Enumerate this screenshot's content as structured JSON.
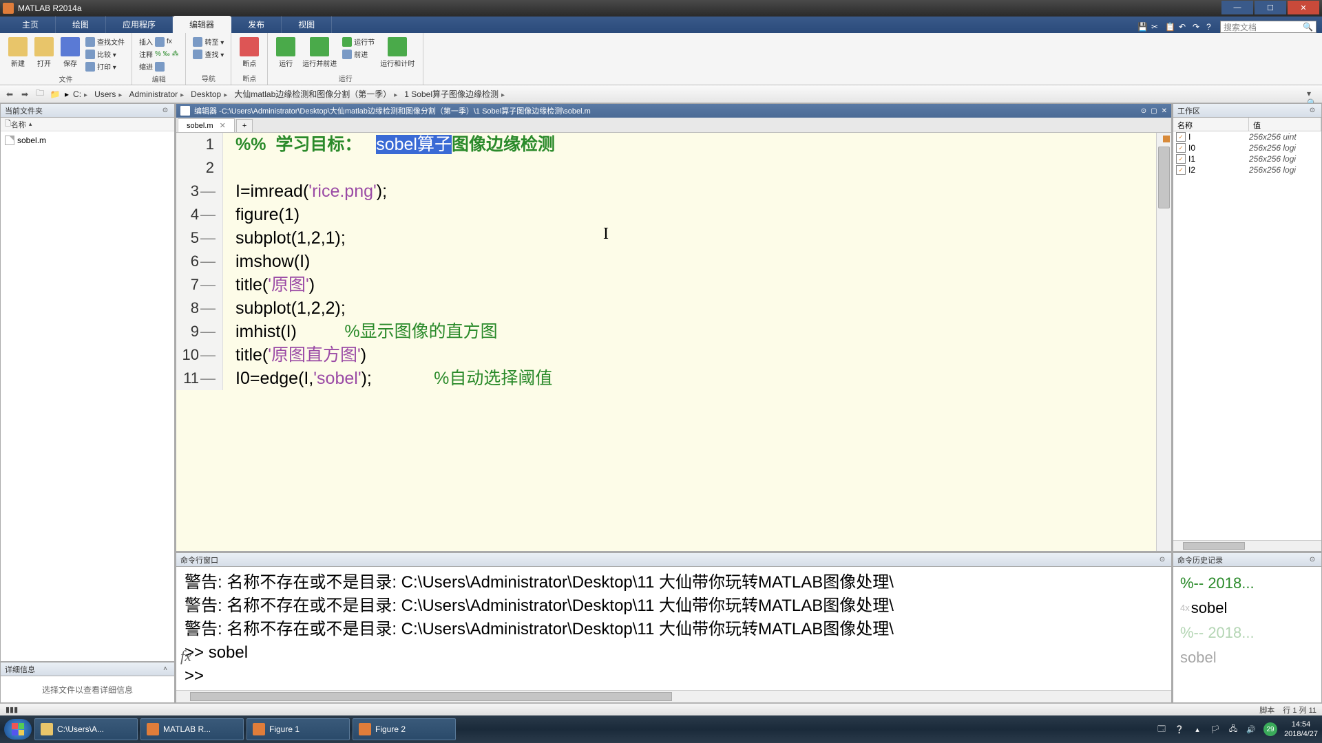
{
  "app_title": "MATLAB R2014a",
  "ribbon_tabs": [
    "主页",
    "绘图",
    "应用程序",
    "编辑器",
    "发布",
    "视图"
  ],
  "ribbon_active": 3,
  "search_placeholder": "搜索文档",
  "toolstrip": {
    "g1": {
      "new": "新建",
      "open": "打开",
      "save": "保存",
      "findfiles": "查找文件",
      "compare": "比较 ▾",
      "print": "打印 ▾",
      "label": "文件"
    },
    "g2": {
      "insert": "插入",
      "fx": "fx",
      "comment": "注释",
      "indent": "缩进",
      "label": "编辑"
    },
    "g3": {
      "goto": "转至 ▾",
      "find": "查找 ▾",
      "label": "导航"
    },
    "g4": {
      "bp": "断点",
      "label": "断点"
    },
    "g5": {
      "run": "运行",
      "runadv": "运行并前进",
      "runsec": "运行节",
      "advance": "前进",
      "runtime": "运行和计时",
      "label": "运行"
    }
  },
  "breadcrumbs": [
    "C:",
    "Users",
    "Administrator",
    "Desktop",
    "大仙matlab边缘检测和图像分割（第一季）",
    "1 Sobel算子图像边缘检测"
  ],
  "left": {
    "cf_title": "当前文件夹",
    "name_col": "名称",
    "files": [
      "sobel.m"
    ],
    "details_title": "详细信息",
    "details_msg": "选择文件以查看详细信息"
  },
  "editor": {
    "hd_prefix": "编辑器 - ",
    "hd_path": "C:\\Users\\Administrator\\Desktop\\大仙matlab边缘检测和图像分割（第一季）\\1 Sobel算子图像边缘检测\\sobel.m",
    "tab": "sobel.m",
    "lines": [
      {
        "n": "1",
        "dash": "",
        "html": [
          "<span class='kw-c'>%%  学习目标：   </span><span class='sel'>sobel算子</span><span class='kw-c'>图像边缘检测</span>"
        ]
      },
      {
        "n": "2",
        "dash": "",
        "html": [
          ""
        ]
      },
      {
        "n": "3",
        "dash": "—",
        "html": [
          "I=imread(<span class='str'>'rice.png'</span>);"
        ]
      },
      {
        "n": "4",
        "dash": "—",
        "html": [
          "figure(1)"
        ]
      },
      {
        "n": "5",
        "dash": "—",
        "html": [
          "subplot(1,2,1);"
        ]
      },
      {
        "n": "6",
        "dash": "—",
        "html": [
          "imshow(I)"
        ]
      },
      {
        "n": "7",
        "dash": "—",
        "html": [
          "title(<span class='str'>'原图'</span>)"
        ]
      },
      {
        "n": "8",
        "dash": "—",
        "html": [
          "subplot(1,2,2);"
        ]
      },
      {
        "n": "9",
        "dash": "—",
        "html": [
          "imhist(I)          <span class='cmt'>%显示图像的直方图</span>"
        ]
      },
      {
        "n": "10",
        "dash": "—",
        "html": [
          "title(<span class='str'>'原图直方图'</span>)"
        ]
      },
      {
        "n": "11",
        "dash": "—",
        "html": [
          "I0=edge(I,<span class='str'>'sobel'</span>);             <span class='cmt'>%自动选择阈值</span>"
        ]
      }
    ]
  },
  "cmd": {
    "title": "命令行窗口",
    "lines": [
      "警告: 名称不存在或不是目录: C:\\Users\\Administrator\\Desktop\\11  大仙带你玩转MATLAB图像处理\\",
      "警告: 名称不存在或不是目录: C:\\Users\\Administrator\\Desktop\\11  大仙带你玩转MATLAB图像处理\\",
      "警告: 名称不存在或不是目录: C:\\Users\\Administrator\\Desktop\\11  大仙带你玩转MATLAB图像处理\\",
      ">> sobel",
      ">> "
    ]
  },
  "workspace": {
    "title": "工作区",
    "cols": {
      "name": "名称",
      "value": "值"
    },
    "vars": [
      {
        "n": "I",
        "v": "256x256 uint"
      },
      {
        "n": "I0",
        "v": "256x256 logi"
      },
      {
        "n": "I1",
        "v": "256x256 logi"
      },
      {
        "n": "I2",
        "v": "256x256 logi"
      }
    ]
  },
  "history": {
    "title": "命令历史记录",
    "items": [
      {
        "t": "%-- 2018...",
        "c": "hc"
      },
      {
        "t": "sobel",
        "c": "",
        "pre": "4x"
      },
      {
        "t": "%-- 2018...",
        "c": "hc dim"
      },
      {
        "t": "sobel",
        "c": "dim"
      }
    ]
  },
  "status": {
    "left": "",
    "script": "脚本",
    "pos": "行 1  列 11"
  },
  "taskbar": {
    "items": [
      {
        "label": "C:\\Users\\A...",
        "cls": "folder"
      },
      {
        "label": "MATLAB R...",
        "cls": ""
      },
      {
        "label": "Figure 1",
        "cls": ""
      },
      {
        "label": "Figure 2",
        "cls": ""
      }
    ],
    "badge": "29",
    "time": "14:54",
    "date": "2018/4/27"
  }
}
